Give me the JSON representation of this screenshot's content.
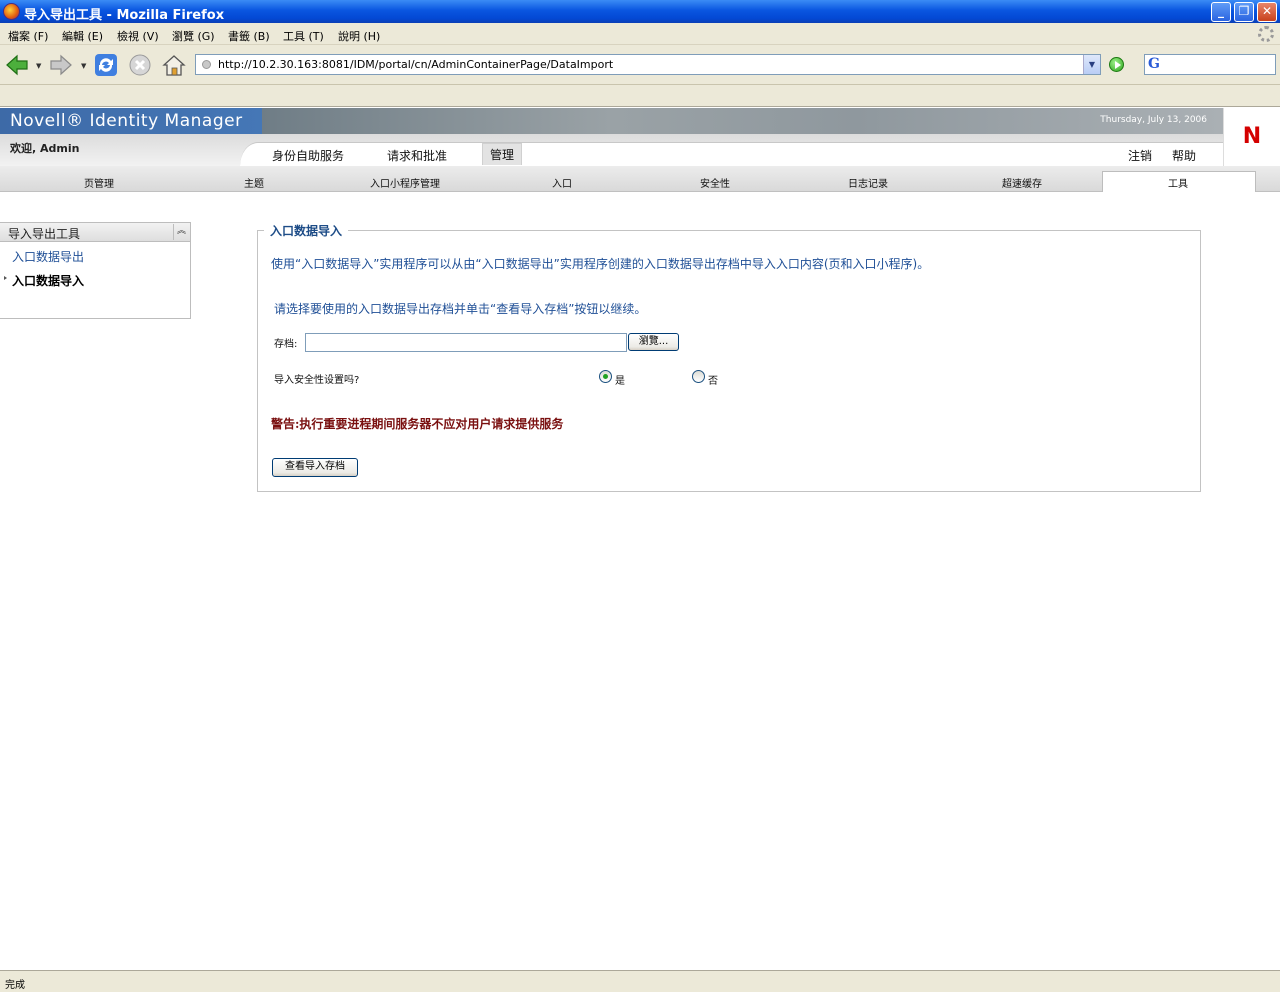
{
  "window": {
    "title": "导入导出工具 - Mozilla Firefox"
  },
  "menu": [
    "檔案 (F)",
    "編輯 (E)",
    "檢視 (V)",
    "瀏覽 (G)",
    "書籤 (B)",
    "工具 (T)",
    "說明 (H)"
  ],
  "url": "http://10.2.30.163:8081/IDM/portal/cn/AdminContainerPage/DataImport",
  "header": {
    "brand": "Novell® Identity Manager",
    "date": "Thursday, July 13, 2006",
    "welcome": "欢迎, Admin",
    "logo": "N",
    "top_tabs": [
      "身份自助服务",
      "请求和批准",
      "管理"
    ],
    "active_top_tab": "管理",
    "util_links": [
      "注销",
      "帮助"
    ],
    "sub_tabs": [
      "页管理",
      "主题",
      "入口小程序管理",
      "入口",
      "安全性",
      "日志记录",
      "超速缓存",
      "工具"
    ],
    "active_sub_tab": "工具"
  },
  "left_panel": {
    "title": "导入导出工具",
    "links": [
      "入口数据导出",
      "入口数据导入"
    ],
    "active": "入口数据导入"
  },
  "main": {
    "legend": "入口数据导入",
    "description": "使用“入口数据导入”实用程序可以从由“入口数据导出”实用程序创建的入口数据导出存档中导入入口内容(页和入口小程序)。",
    "instruction": "请选择要使用的入口数据导出存档并单击“查看导入存档”按钮以继续。",
    "archive_label": "存档:",
    "archive_value": "",
    "browse_label": "瀏覽...",
    "security_question": "导入安全性设置吗?",
    "yes_label": "是",
    "no_label": "否",
    "security_selected": "yes",
    "warning": "警告:执行重要进程期间服务器不应对用户请求提供服务",
    "view_button": "查看导入存档"
  },
  "status": "完成",
  "colors": {
    "link": "#1f4f96",
    "warning": "#7a1010",
    "brand_blue": "#3d6aa7",
    "logo_red": "#d40000"
  }
}
